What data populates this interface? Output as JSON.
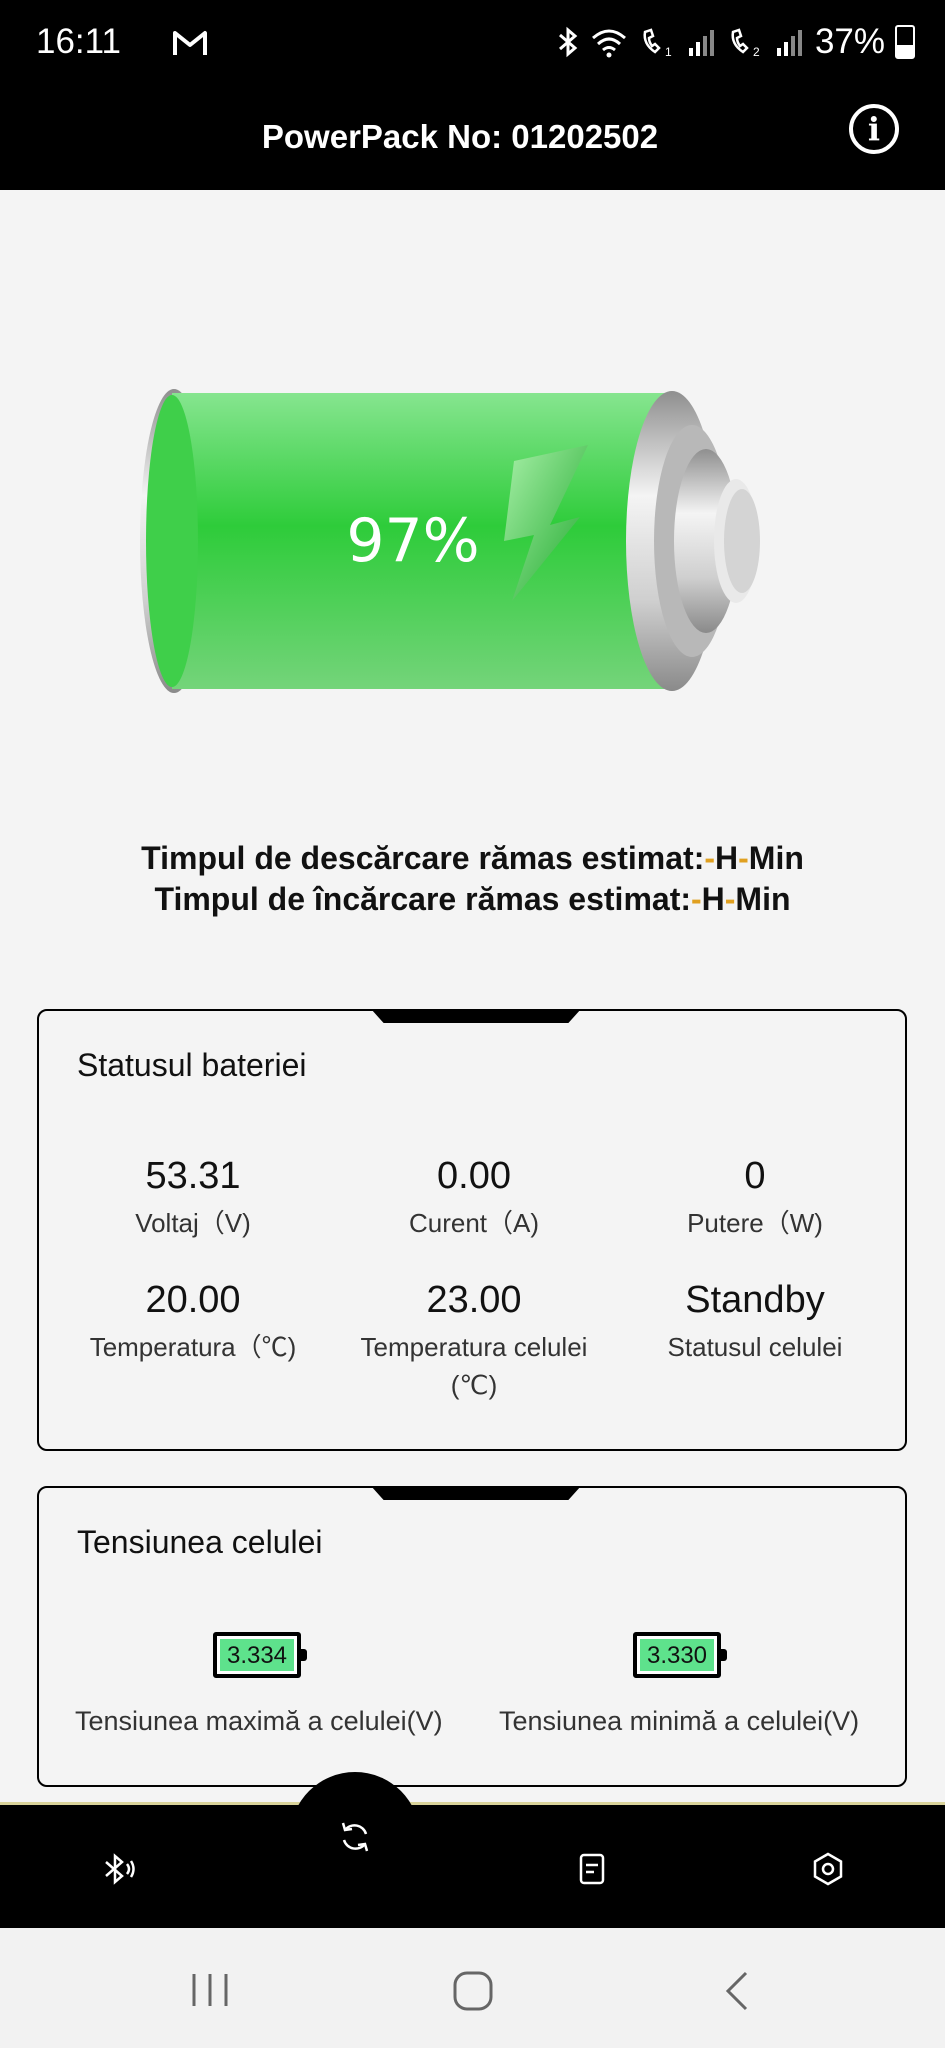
{
  "status_bar": {
    "time": "16:11",
    "battery_percent": "37%"
  },
  "header": {
    "title": "PowerPack No: 01202502",
    "info_icon": "info-icon"
  },
  "battery": {
    "percent": "97%",
    "level": 0.97
  },
  "estimates": {
    "discharge_label": "Timpul de descărcare rămas estimat:",
    "charge_label": "Timpul de încărcare rămas estimat:",
    "dash": "-",
    "hours_unit": "H",
    "minutes_unit": "Min"
  },
  "battery_status": {
    "title": "Statusul bateriei",
    "items": [
      {
        "value": "53.31",
        "label": "Voltaj（V)"
      },
      {
        "value": "0.00",
        "label": "Curent（A)"
      },
      {
        "value": "0",
        "label": "Putere（W)"
      },
      {
        "value": "20.00",
        "label": "Temperatura（℃)"
      },
      {
        "value": "23.00",
        "label": "Temperatura celulei (℃)"
      },
      {
        "value": "Standby",
        "label": "Statusul celulei"
      }
    ]
  },
  "cell_voltage": {
    "title": "Tensiunea celulei",
    "max_value": "3.334",
    "max_label": "Tensiunea maximă a celulei(V)",
    "min_value": "3.330",
    "min_label": "Tensiunea minimă a celulei(V)"
  },
  "bottom_nav": {
    "items": [
      "bluetooth-icon",
      "refresh-icon",
      "document-icon",
      "settings-icon"
    ],
    "accent": "#d9d39a"
  },
  "system_nav": [
    "recents-icon",
    "home-icon",
    "back-icon"
  ]
}
